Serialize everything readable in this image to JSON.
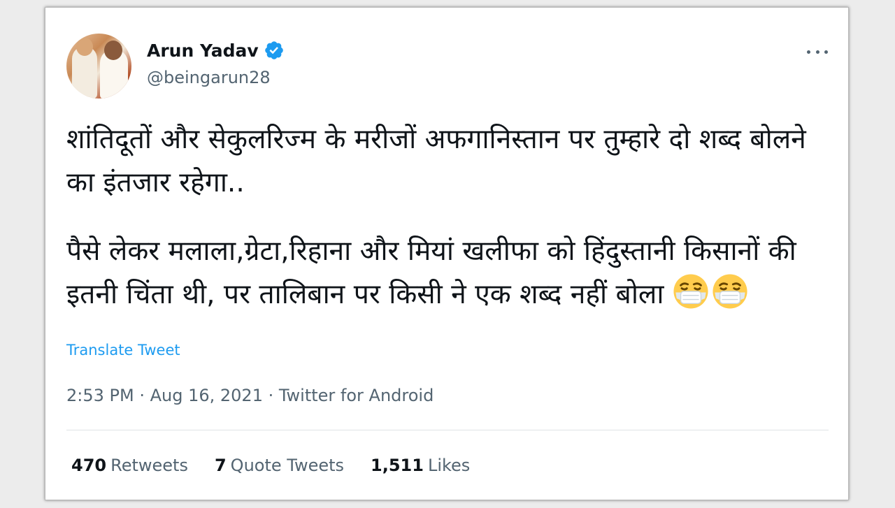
{
  "tweet": {
    "author_name": "Arun Yadav",
    "author_handle": "@beingarun28",
    "verified_icon": "verified-badge-icon",
    "more_icon": "more-dots-icon",
    "paragraph_1": "शांतिदूतों और सेकुलरिज्म के मरीजों अफगानिस्तान पर तुम्हारे दो शब्द बोलने का इंतजार रहेगा..",
    "paragraph_2": "पैसे लेकर मलाला,ग्रेटा,रिहाना और मियां खलीफा को हिंदुस्तानी किसानों की इतनी चिंता थी, पर तालिबान पर किसी ने एक शब्द नहीं बोला",
    "emojis": [
      "face-with-medical-mask",
      "face-with-medical-mask"
    ],
    "translate_label": "Translate Tweet",
    "meta": "2:53 PM · Aug 16, 2021 · Twitter for Android"
  },
  "stats": {
    "retweets_count": "470",
    "retweets_label": "Retweets",
    "quote_count": "7",
    "quote_label": "Quote Tweets",
    "likes_count": "1,511",
    "likes_label": "Likes"
  },
  "colors": {
    "link": "#1d9bf0",
    "text": "#0f1419",
    "secondary": "#536471",
    "background": "#ececec"
  }
}
